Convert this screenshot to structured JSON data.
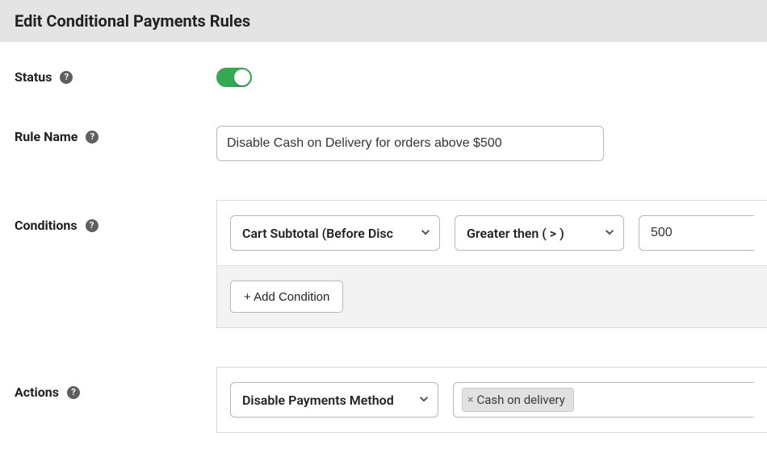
{
  "header": {
    "title": "Edit Conditional Payments Rules"
  },
  "fields": {
    "status": {
      "label": "Status",
      "value": true
    },
    "ruleName": {
      "label": "Rule Name",
      "value": "Disable Cash on Delivery for orders above $500"
    },
    "conditions": {
      "label": "Conditions",
      "rows": [
        {
          "field": "Cart Subtotal (Before Disc",
          "operator": "Greater then ( > )",
          "value": "500"
        }
      ],
      "addLabel": "+ Add Condition"
    },
    "actions": {
      "label": "Actions",
      "action": "Disable Payments Method",
      "tags": [
        "Cash on delivery"
      ]
    }
  }
}
